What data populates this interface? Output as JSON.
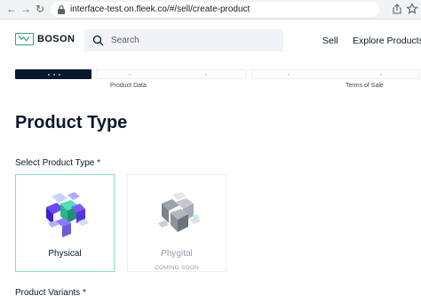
{
  "browser": {
    "url": "interface-test.on.fleek.co/#/sell/create-product",
    "back_icon": "arrow-left-icon",
    "forward_icon": "arrow-right-icon",
    "reload_icon": "reload-icon",
    "lock_icon": "lock-icon",
    "share_icon": "share-icon",
    "bookmark_icon": "star-icon"
  },
  "header": {
    "logo_text": "BOSON",
    "search_placeholder": "Search",
    "nav": [
      "Sell",
      "Explore Products"
    ]
  },
  "stepper": {
    "steps": [
      {
        "label": "",
        "active": true
      },
      {
        "label": "Product Data",
        "active": false
      },
      {
        "label": "",
        "active": false
      },
      {
        "label": "Terms of Sale",
        "active": false
      }
    ]
  },
  "main": {
    "title": "Product Type",
    "select_label": "Select Product Type *",
    "types": [
      {
        "label": "Physical",
        "selected": true,
        "disabled": false,
        "note": ""
      },
      {
        "label": "Phygital",
        "selected": false,
        "disabled": true,
        "note": "COMING SOON"
      }
    ],
    "variants_label": "Product Variants *"
  },
  "colors": {
    "brand": "#09182c",
    "accent": "#50e3c2",
    "selected_border": "#80e2c4"
  }
}
